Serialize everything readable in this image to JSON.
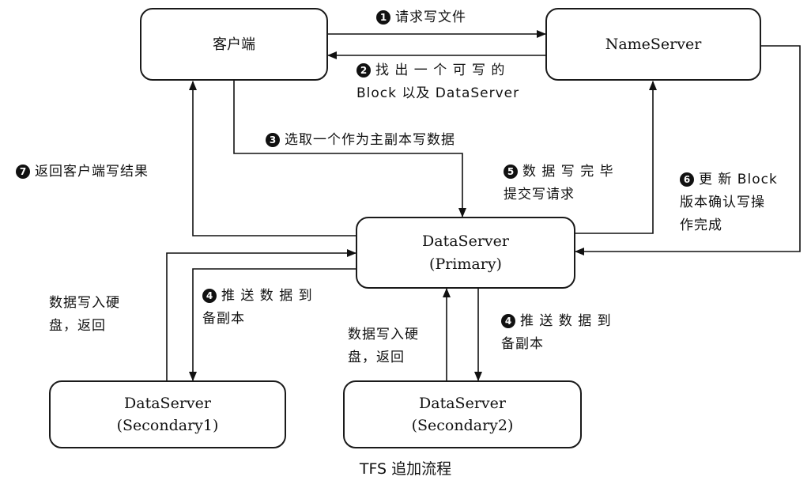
{
  "nodes": {
    "client": "客户端",
    "nameserver": "NameServer",
    "primary": [
      "DataServer",
      "(Primary)"
    ],
    "secondary1": [
      "DataServer",
      "(Secondary1)"
    ],
    "secondary2": [
      "DataServer",
      "(Secondary2)"
    ]
  },
  "steps": {
    "s1": {
      "badge": "1",
      "lines": [
        "请求写文件"
      ]
    },
    "s2": {
      "badge": "2",
      "lines": [
        "找 出 一 个 可 写 的",
        "Block 以及 DataServer"
      ]
    },
    "s3": {
      "badge": "3",
      "lines": [
        "选取一个作为主副本写数据"
      ]
    },
    "s4a": {
      "badge": "4",
      "lines": [
        "推 送 数 据 到",
        "备副本"
      ]
    },
    "s4b": {
      "badge": "4",
      "lines": [
        "推 送 数 据 到",
        "备副本"
      ]
    },
    "s5": {
      "badge": "5",
      "lines": [
        "数 据 写 完 毕",
        "提交写请求"
      ]
    },
    "s6": {
      "badge": "6",
      "lines": [
        "更 新 Block",
        "版本确认写操",
        "作完成"
      ]
    },
    "s7": {
      "badge": "7",
      "lines": [
        "返回客户端写结果"
      ]
    }
  },
  "notes": {
    "n1": [
      "数据写入硬",
      "盘，返回"
    ],
    "n2": [
      "数据写入硬",
      "盘，返回"
    ]
  },
  "caption": "TFS 追加流程"
}
